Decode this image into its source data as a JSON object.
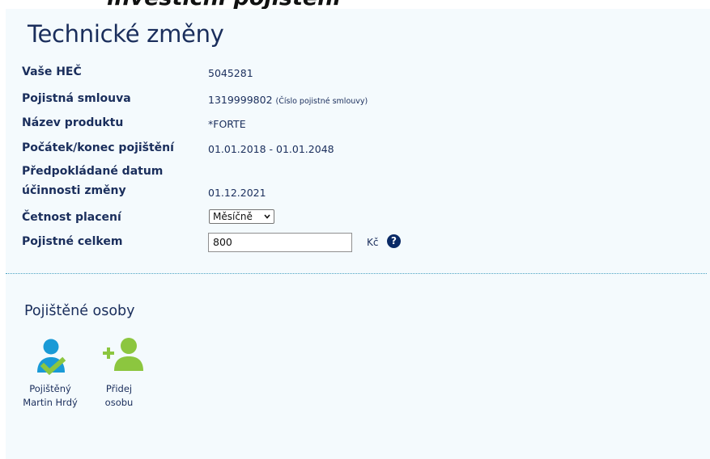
{
  "header": {
    "partial_title": "investiční pojištění"
  },
  "page_title": "Technické změny",
  "fields": [
    {
      "label": "Vaše HEČ",
      "value": "5045281"
    },
    {
      "label": "Pojistná smlouva",
      "value": "1319999802",
      "note": "(Číslo pojistné smlouvy)"
    },
    {
      "label": "Název produktu",
      "value": "*FORTE"
    },
    {
      "label": "Počátek/konec pojištění",
      "value": "01.01.2018 - 01.01.2048"
    },
    {
      "label_line1": "Předpokládané datum",
      "label_line2": "účinnosti změny",
      "value": "01.12.2021"
    }
  ],
  "payment_frequency": {
    "label": "Četnost placení",
    "selected": "Měsíčně"
  },
  "premium_total": {
    "label": "Pojistné celkem",
    "value": "800",
    "unit": "Kč",
    "help": "?"
  },
  "insured_persons": {
    "title": "Pojištěné osoby",
    "items": [
      {
        "line1": "Pojištěný",
        "line2": "Martin Hrdý",
        "icon": "person-check-icon"
      },
      {
        "line1": "Přidej",
        "line2": "osobu",
        "icon": "add-person-icon"
      }
    ]
  },
  "colors": {
    "navy": "#1a2e5c",
    "panel": "#f4fafd",
    "blue": "#1a9ad6",
    "green": "#8cc63f"
  }
}
